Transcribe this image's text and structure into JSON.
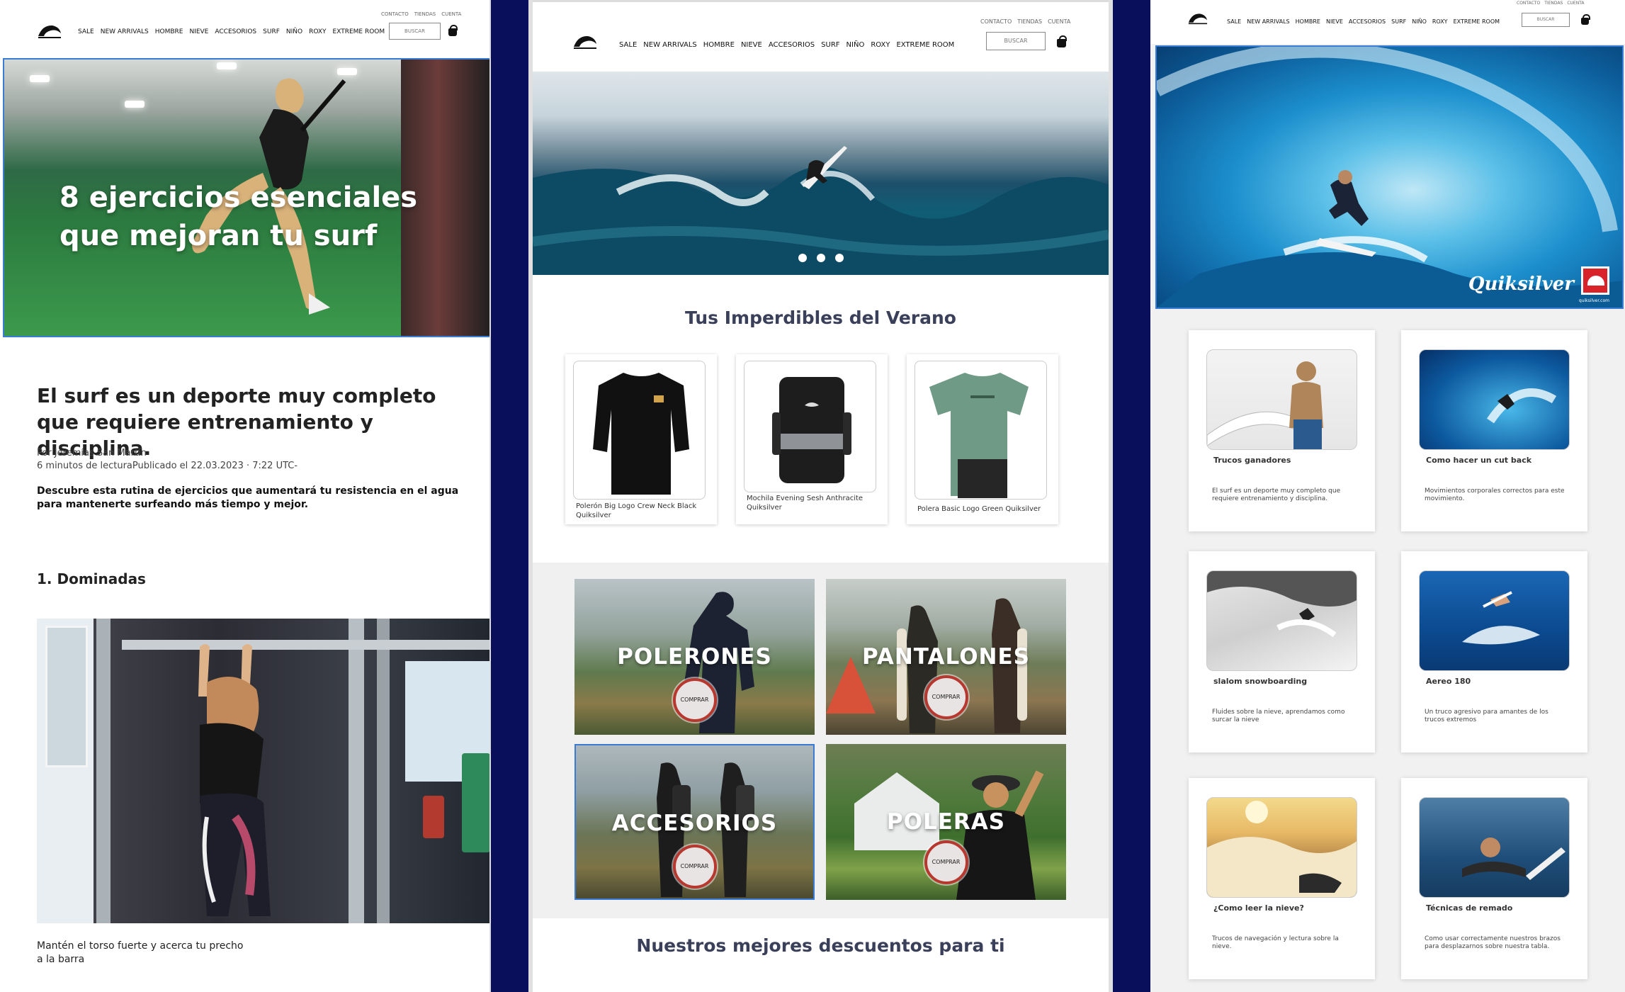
{
  "header": {
    "nav": [
      "SALE",
      "NEW ARRIVALS",
      "HOMBRE",
      "NIEVE",
      "ACCESORIOS",
      "SURF",
      "NIÑO",
      "ROXY",
      "EXTREME ROOM"
    ],
    "utility": [
      "CONTACTO",
      "TIENDAS",
      "CUENTA"
    ],
    "search_label": "BUSCAR"
  },
  "left": {
    "hero_title": "8 ejercicios esenciales que mejoran tu surf",
    "heading": "El surf es un deporte muy completo que requiere entrenamiento y disciplina.",
    "author": "Por Jeremías San Martín",
    "meta": "6 minutos de lecturaPublicado el 22.03.2023 · 7:22 UTC-",
    "lead": "Descubre esta rutina de ejercicios que aumentará tu resistencia en el agua para mantenerte surfeando más tiempo y mejor.",
    "section": "1. Dominadas",
    "caption": "Mantén el torso fuerte y acerca tu precho a la barra"
  },
  "middle": {
    "section_title": "Tus Imperdibles del Verano",
    "products": [
      {
        "name": "Polerón Big Logo Crew Neck Black Quiksilver"
      },
      {
        "name": "Mochila Evening Sesh Anthracite Quiksilver"
      },
      {
        "name": "Polera Basic Logo Green Quiksilver"
      }
    ],
    "categories": [
      {
        "label": "POLERONES",
        "button": "COMPRAR"
      },
      {
        "label": "PANTALONES",
        "button": "COMPRAR"
      },
      {
        "label": "ACCESORIOS",
        "button": "COMPRAR"
      },
      {
        "label": "POLERAS",
        "button": "COMPRAR"
      }
    ],
    "discounts_title": "Nuestros mejores descuentos para ti"
  },
  "right": {
    "hero_brand": "Quiksilver",
    "hero_url": "quiksilver.com",
    "cards": [
      {
        "title": "Trucos ganadores",
        "desc": "El surf es un deporte muy completo que requiere  entrenamiento y disciplina."
      },
      {
        "title": "Como hacer un cut back",
        "desc": "Movimientos corporales correctos para este movimiento."
      },
      {
        "title": "slalom snowboarding",
        "desc": "Fluides sobre la nieve, aprendamos como surcar la nieve"
      },
      {
        "title": "Aereo 180",
        "desc": "Un truco agresivo para amantes de los trucos extremos"
      },
      {
        "title": "¿Como leer la nieve?",
        "desc": "Trucos de navegación y lectura sobre la nieve."
      },
      {
        "title": "Técnicas de remado",
        "desc": "Como usar correctamente nuestros brazos para desplazarnos sobre nuestra tabla."
      }
    ]
  }
}
